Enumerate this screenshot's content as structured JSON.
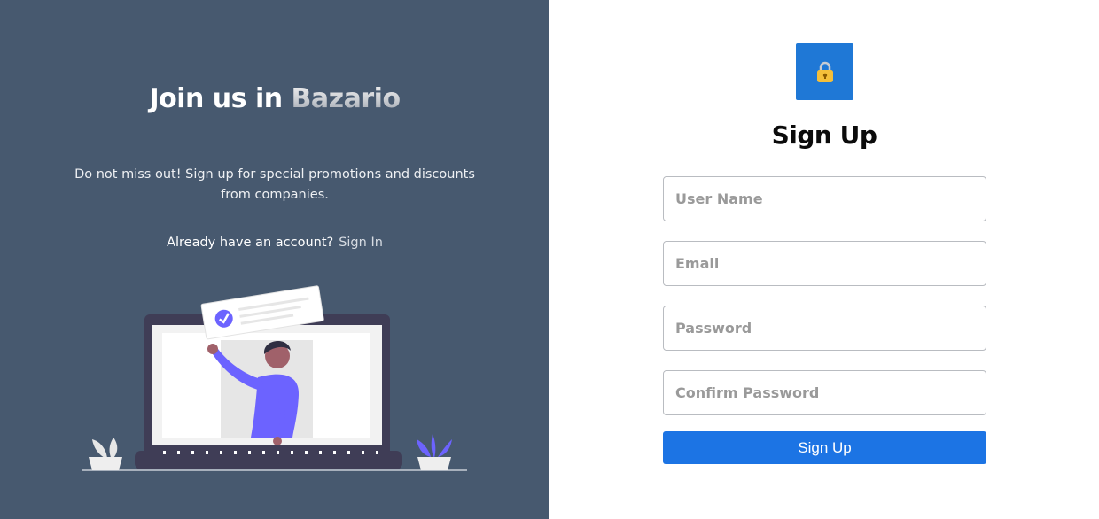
{
  "left": {
    "headline_prefix": "Join us in ",
    "brand": "Bazario",
    "promo": "Do not miss out! Sign up for special promotions and discounts from companies.",
    "signin_prompt": "Already have an account?",
    "signin_link": "Sign In"
  },
  "form": {
    "title": "Sign Up",
    "fields": {
      "username": {
        "placeholder": "User Name",
        "value": ""
      },
      "email": {
        "placeholder": "Email",
        "value": ""
      },
      "password": {
        "placeholder": "Password",
        "value": ""
      },
      "confirm": {
        "placeholder": "Confirm Password",
        "value": ""
      }
    },
    "submit_label": "Sign Up"
  },
  "icons": {
    "lock": "lock-icon",
    "check": "check-icon"
  },
  "colors": {
    "left_bg": "#47596f",
    "accent": "#1f78d6",
    "button": "#1c74e4",
    "illustration_person": "#6c63ff",
    "laptop": "#3f3d56"
  }
}
